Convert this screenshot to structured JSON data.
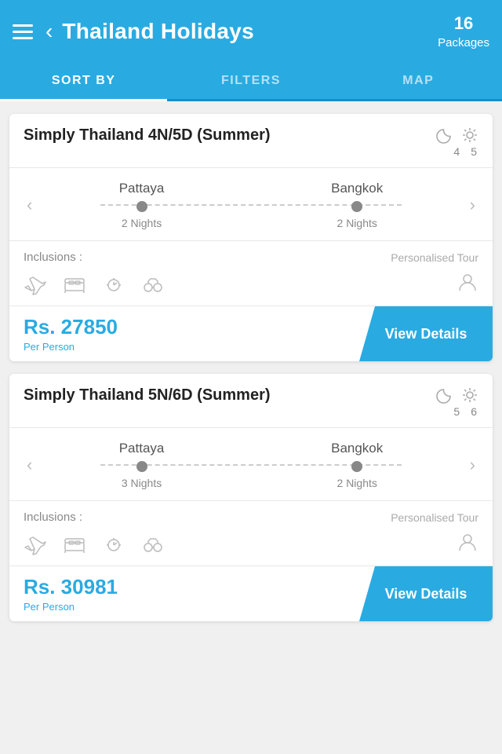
{
  "header": {
    "title": "Thailand Holidays",
    "packages_count": "16",
    "packages_label": "Packages"
  },
  "tabs": [
    {
      "id": "sort",
      "label": "SORT BY",
      "active": true
    },
    {
      "id": "filters",
      "label": "FILTERS",
      "active": false
    },
    {
      "id": "map",
      "label": "MAP",
      "active": false
    }
  ],
  "packages": [
    {
      "id": 1,
      "title": "Simply Thailand 4N/5D (Summer)",
      "nights": "4",
      "days": "5",
      "cities": [
        {
          "name": "Pattaya",
          "nights": "2 Nights"
        },
        {
          "name": "Bangkok",
          "nights": "2 Nights"
        }
      ],
      "inclusions_label": "Inclusions :",
      "personalised_label": "Personalised Tour",
      "price": "Rs. 27850",
      "price_per": "Per Person",
      "cta": "View Details"
    },
    {
      "id": 2,
      "title": "Simply Thailand 5N/6D (Summer)",
      "nights": "5",
      "days": "6",
      "cities": [
        {
          "name": "Pattaya",
          "nights": "3 Nights"
        },
        {
          "name": "Bangkok",
          "nights": "2 Nights"
        }
      ],
      "inclusions_label": "Inclusions :",
      "personalised_label": "Personalised Tour",
      "price": "Rs. 30981",
      "price_per": "Per Person",
      "cta": "View Details"
    }
  ]
}
